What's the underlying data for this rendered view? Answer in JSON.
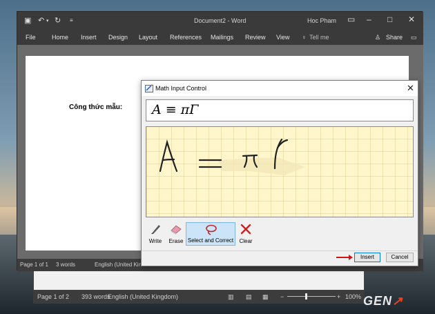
{
  "word_window": {
    "title": "Document2  -  Word",
    "user": "Hoc Pham",
    "tabs": [
      "File",
      "Home",
      "Insert",
      "Design",
      "Layout",
      "References",
      "Mailings",
      "Review",
      "View"
    ],
    "tell_me": "Tell me",
    "share": "Share",
    "document_text": "Công thức mẫu:",
    "status": {
      "page": "Page 1 of 1",
      "words": "3 words",
      "language": "English (United Kin"
    }
  },
  "back_window": {
    "status": {
      "page": "Page 1 of 2",
      "words": "393 words",
      "language": "English (United Kingdom)",
      "zoom": "100%"
    }
  },
  "math_dialog": {
    "title": "Math Input Control",
    "preview_expression": "A ≡ πΓ",
    "tools": {
      "write": "Write",
      "erase": "Erase",
      "select_correct": "Select and Correct",
      "clear": "Clear"
    },
    "insert_label": "Insert",
    "cancel_label": "Cancel"
  },
  "watermark": {
    "text": "GEN",
    "accent_color": "#e8431f"
  },
  "colors": {
    "word_dark": "#3a3a3a",
    "ink_pad": "#fff6cc",
    "selected_tool": "#cce4f7",
    "arrow": "#d01515"
  }
}
